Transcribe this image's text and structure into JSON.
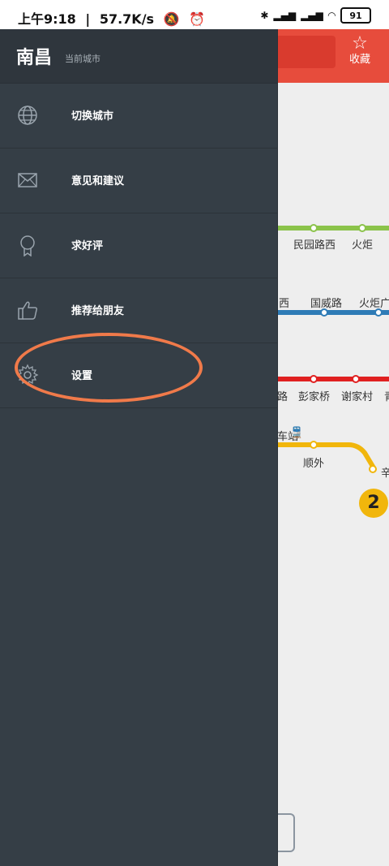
{
  "status_bar": {
    "time": "上午9:18",
    "speed": "57.7K/s",
    "battery": "91"
  },
  "header": {
    "favorite_label": "收藏"
  },
  "drawer": {
    "city": "南昌",
    "city_subtitle": "当前城市",
    "items": [
      {
        "label": "切换城市",
        "icon": "globe-icon"
      },
      {
        "label": "意见和建议",
        "icon": "mail-icon"
      },
      {
        "label": "求好评",
        "icon": "award-icon"
      },
      {
        "label": "推荐给朋友",
        "icon": "thumbs-up-icon"
      },
      {
        "label": "设置",
        "icon": "gear-icon"
      }
    ]
  },
  "map": {
    "stations": [
      "民园路西",
      "火炬",
      "西",
      "国威路",
      "火炬广",
      "路",
      "彭家桥",
      "谢家村",
      "青",
      "车站",
      "顺外",
      "辛"
    ],
    "line_badge": "2",
    "colors": {
      "green_line": "#8bc34a",
      "blue_line": "#2e7bb6",
      "red_line": "#e02020",
      "yellow_line": "#f1b60c"
    }
  },
  "annotation": {
    "color": "#f07a4a"
  }
}
